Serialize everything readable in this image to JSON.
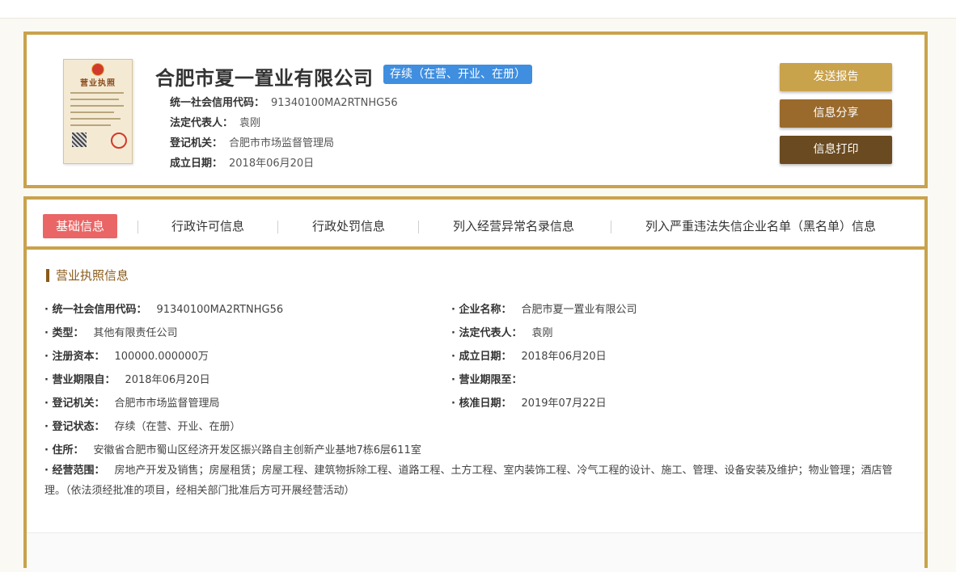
{
  "header": {
    "company_name": "合肥市夏一置业有限公司",
    "status_badge": "存续（在营、开业、在册）",
    "license_image_title": "营业执照",
    "fields": [
      {
        "label": "统一社会信用代码：",
        "value": "91340100MA2RTNHG56"
      },
      {
        "label": "法定代表人：",
        "value": "袁刚"
      },
      {
        "label": "登记机关：",
        "value": "合肥市市场监督管理局"
      },
      {
        "label": "成立日期：",
        "value": "2018年06月20日"
      }
    ],
    "buttons": {
      "send_report": "发送报告",
      "share": "信息分享",
      "print": "信息打印"
    }
  },
  "tabs": [
    {
      "label": "基础信息",
      "active": true
    },
    {
      "label": "行政许可信息",
      "active": false
    },
    {
      "label": "行政处罚信息",
      "active": false
    },
    {
      "label": "列入经营异常名录信息",
      "active": false
    },
    {
      "label": "列入严重违法失信企业名单（黑名单）信息",
      "active": false
    }
  ],
  "section": {
    "title": "营业执照信息",
    "fields": {
      "credit_code": {
        "label": "· 统一社会信用代码：",
        "value": "91340100MA2RTNHG56"
      },
      "company_name": {
        "label": "· 企业名称：",
        "value": "合肥市夏一置业有限公司"
      },
      "type": {
        "label": "· 类型：",
        "value": "其他有限责任公司"
      },
      "legal_rep": {
        "label": "· 法定代表人：",
        "value": "袁刚"
      },
      "capital": {
        "label": "· 注册资本：",
        "value": "100000.000000万"
      },
      "established": {
        "label": "· 成立日期：",
        "value": "2018年06月20日"
      },
      "term_from": {
        "label": "· 营业期限自：",
        "value": "2018年06月20日"
      },
      "term_to": {
        "label": "· 营业期限至：",
        "value": ""
      },
      "authority": {
        "label": "· 登记机关：",
        "value": "合肥市市场监督管理局"
      },
      "approval_date": {
        "label": "· 核准日期：",
        "value": "2019年07月22日"
      },
      "reg_status": {
        "label": "· 登记状态：",
        "value": "存续（在营、开业、在册）"
      },
      "address": {
        "label": "· 住所：",
        "value": "安徽省合肥市蜀山区经济开发区振兴路自主创新产业基地7栋6层611室"
      },
      "scope": {
        "label": "· 经营范围：",
        "value": "房地产开发及销售；房屋租赁；房屋工程、建筑物拆除工程、道路工程、土方工程、室内装饰工程、冷气工程的设计、施工、管理、设备安装及维护；物业管理；酒店管理。（依法须经批准的项目，经相关部门批准后方可开展经营活动）"
      }
    }
  },
  "colors": {
    "frame": "#c9a24c",
    "badge": "#3f8ee0",
    "active_tab": "#ea6565",
    "btn_send": "#c9a24c",
    "btn_share": "#9a6a2c",
    "btn_print": "#6a4a20",
    "section_title": "#8a5a18"
  }
}
